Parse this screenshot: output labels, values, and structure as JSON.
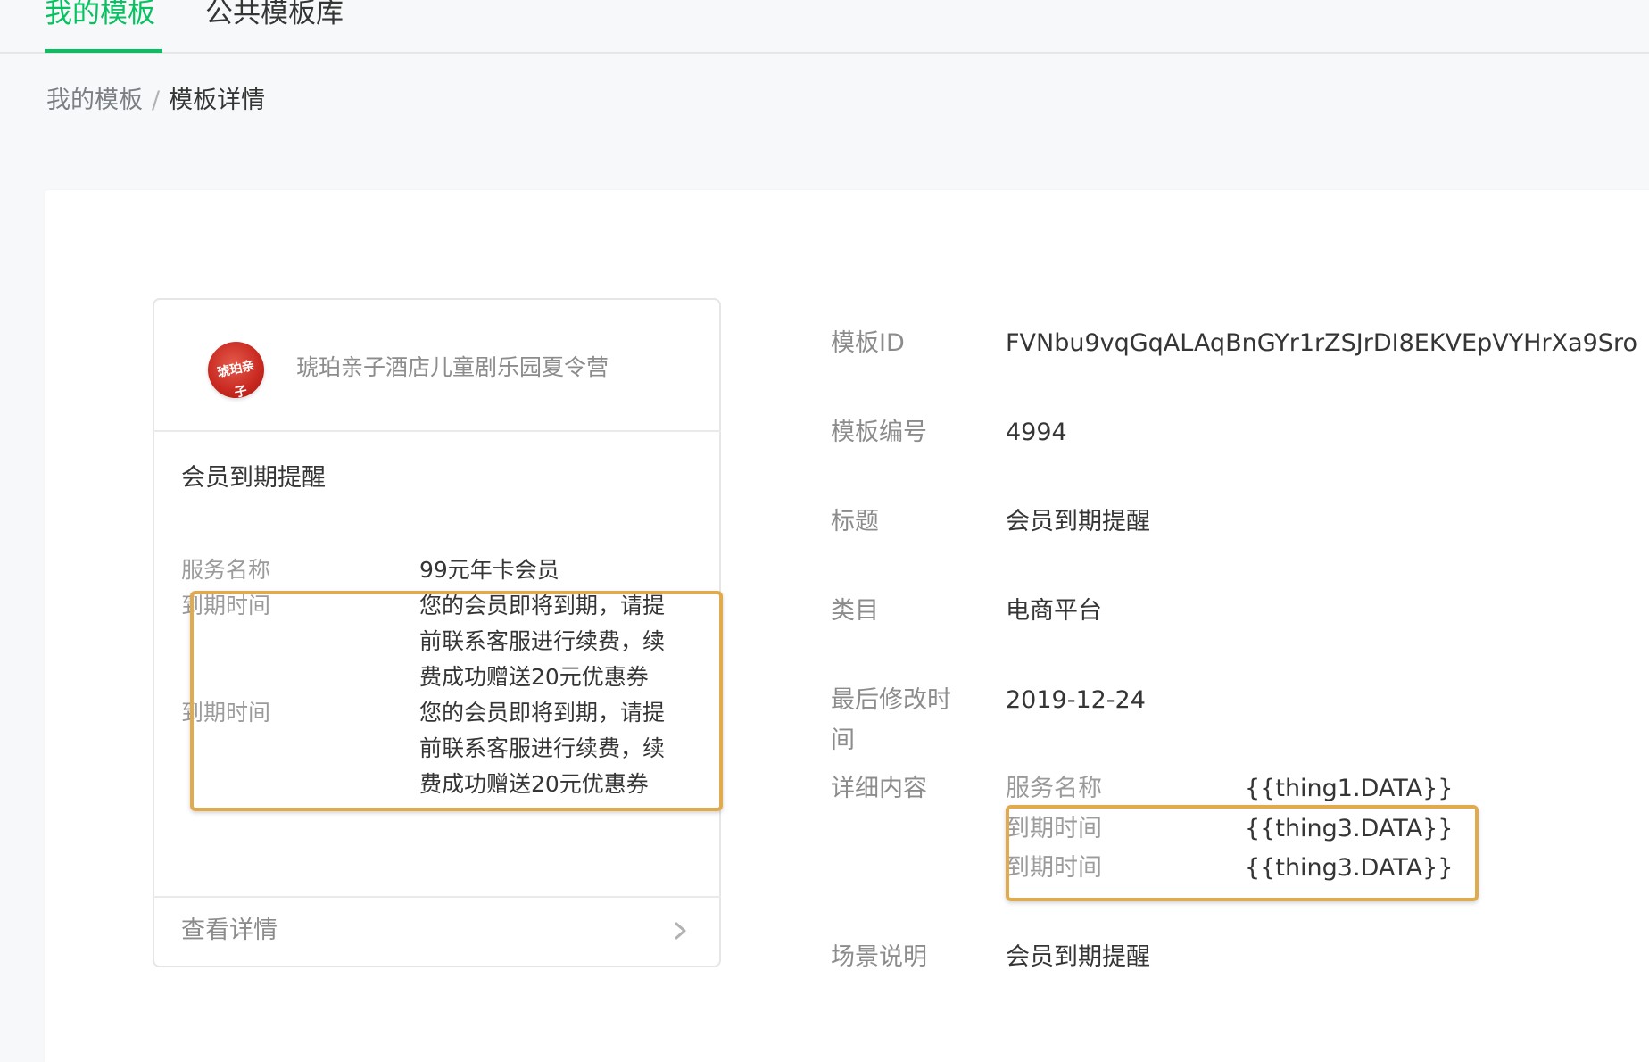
{
  "tabs": [
    {
      "label": "我的模板",
      "active": true
    },
    {
      "label": "公共模板库",
      "active": false
    }
  ],
  "breadcrumb": {
    "parent": "我的模板",
    "separator": "/",
    "current": "模板详情"
  },
  "preview": {
    "logo_text": "琥珀亲子",
    "shop_name": "琥珀亲子酒店儿童剧乐园夏令营",
    "title": "会员到期提醒",
    "fields": [
      {
        "label": "服务名称",
        "value": "99元年卡会员"
      },
      {
        "label": "到期时间",
        "value": "您的会员即将到期，请提前联系客服进行续费，续费成功赠送20元优惠券"
      },
      {
        "label": "到期时间",
        "value": "您的会员即将到期，请提前联系客服进行续费，续费成功赠送20元优惠券"
      }
    ],
    "footer_link": "查看详情"
  },
  "details": {
    "template_id_label": "模板ID",
    "template_id": "FVNbu9vqGqALAqBnGYr1rZSJrDI8EKVEpVYHrXa9Sro",
    "number_label": "模板编号",
    "number": "4994",
    "title_label": "标题",
    "title": "会员到期提醒",
    "category_label": "类目",
    "category": "电商平台",
    "modified_label": "最后修改时间",
    "modified": "2019-12-24",
    "content_label": "详细内容",
    "content": [
      {
        "name": "服务名称",
        "key": "{{thing1.DATA}}"
      },
      {
        "name": "到期时间",
        "key": "{{thing3.DATA}}"
      },
      {
        "name": "到期时间",
        "key": "{{thing3.DATA}}"
      }
    ],
    "scene_label": "场景说明",
    "scene": "会员到期提醒"
  },
  "colors": {
    "accent": "#07c160",
    "highlight": "#e0aa4e"
  }
}
